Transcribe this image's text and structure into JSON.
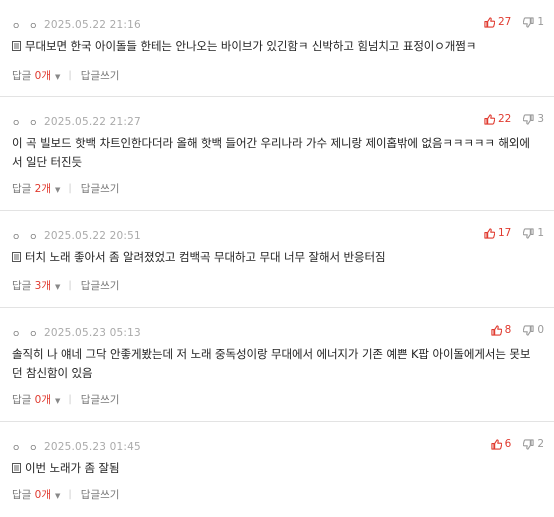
{
  "comments": [
    {
      "dots": "ㅇ ㅇ",
      "date": "2025.05.22 21:16",
      "upvotes": "27",
      "downvotes": "1",
      "body": "무대보면 한국 아이돌들 한테는 안나오는 바이브가 있긴함ㅋ 신박하고 힘넘치고 표정이ㅇ개쩜ㅋ",
      "has_doc_icon": true,
      "reply_label": "답글",
      "reply_count": "0개",
      "write_reply": "답글쓰기"
    },
    {
      "dots": "ㅇ ㅇ",
      "date": "2025.05.22 21:27",
      "upvotes": "22",
      "downvotes": "3",
      "body": "이 곡 빌보드 핫백 차트인한다더라 올해 핫백 들어간 우리나라 가수 제니랑 제이홉밖에 없음ㅋㅋㅋㅋㅋ 해외에서 일단 터진듯",
      "has_doc_icon": false,
      "reply_label": "답글",
      "reply_count": "2개",
      "write_reply": "답글쓰기"
    },
    {
      "dots": "ㅇ ㅇ",
      "date": "2025.05.22 20:51",
      "upvotes": "17",
      "downvotes": "1",
      "body": "터치 노래 좋아서 좀 알려졌었고 컴백곡 무대하고 무대 너무 잘해서 반응터짐",
      "has_doc_icon": true,
      "reply_label": "답글",
      "reply_count": "3개",
      "write_reply": "답글쓰기"
    },
    {
      "dots": "ㅇ ㅇ",
      "date": "2025.05.23 05:13",
      "upvotes": "8",
      "downvotes": "0",
      "body": "솔직히 나 얘네 그닥 안좋게봤는데 저 노래 중독성이랑 무대에서 에너지가 기존 예쁜 K팝 아이돌에게서는 못보던 참신함이 있음",
      "has_doc_icon": false,
      "reply_label": "답글",
      "reply_count": "0개",
      "write_reply": "답글쓰기"
    },
    {
      "dots": "ㅇ ㅇ",
      "date": "2025.05.23 01:45",
      "upvotes": "6",
      "downvotes": "2",
      "body": "이번 노래가 좀 잘됨",
      "has_doc_icon": true,
      "reply_label": "답글",
      "reply_count": "0개",
      "write_reply": "답글쓰기"
    }
  ],
  "icons": {
    "upvote": "thumbs-up-icon",
    "downvote": "thumbs-down-icon",
    "doc": "document-icon",
    "caret": "caret-down-icon"
  },
  "colors": {
    "upvote": "#e03a2f",
    "downvote": "#9a9a9a",
    "reply_count": "#e03a2f",
    "date": "#aaaaaa",
    "divider": "#e3e3e3"
  }
}
